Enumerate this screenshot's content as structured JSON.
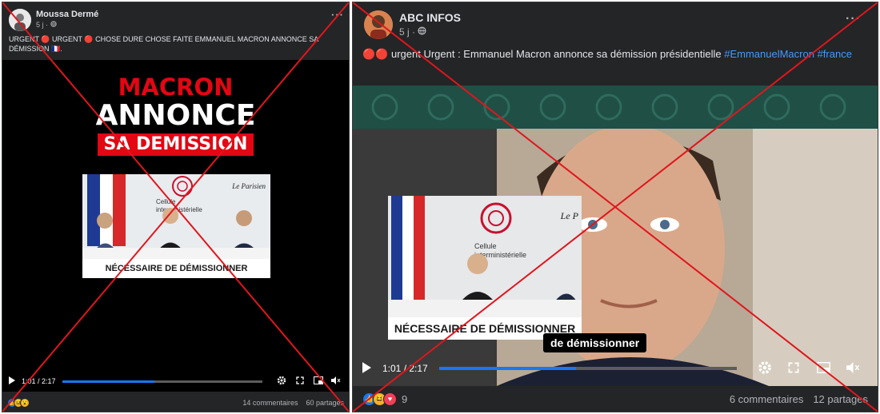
{
  "post1": {
    "author": "Moussa Dermé",
    "time": "5 j ·",
    "caption": "URGENT 🔴 URGENT 🔴 CHOSE DURE CHOSE FAITE EMMANUEL MACRON ANNONCE SA DÉMISSION 🇫🇷.",
    "headline": [
      "MACRON",
      "ANNONCE",
      "SA DEMISSION"
    ],
    "logo": "Le Parisien",
    "banner": "NÉCESSAIRE DE DÉMISSIONNER",
    "sign": "Cellule interministérielle",
    "time_display": "1:01 / 2:17",
    "progress": 0.46,
    "comments": "14 commentaires",
    "shares": "60 partages"
  },
  "post2": {
    "author": "ABC INFOS",
    "time": "5 j ·",
    "caption_prefix": "🔴🔴 urgent Urgent : Emmanuel Macron annonce sa démission présidentielle",
    "hashtag1": "#EmmanuelMacron",
    "hashtag2": "#france",
    "logo": "Le P",
    "banner": "NÉCESSAIRE DE DÉMISSIONNER",
    "sign": "Cellule interministérielle",
    "subtitle": "de démissionner",
    "time_display": "1:01 / 2:17",
    "progress": 0.46,
    "reaction_count": "9",
    "comments": "6 commentaires",
    "shares": "12 partages"
  },
  "colors": {
    "cross": "#e0161e",
    "hashtag": "#4599ff",
    "red_banner": "#e30613"
  }
}
